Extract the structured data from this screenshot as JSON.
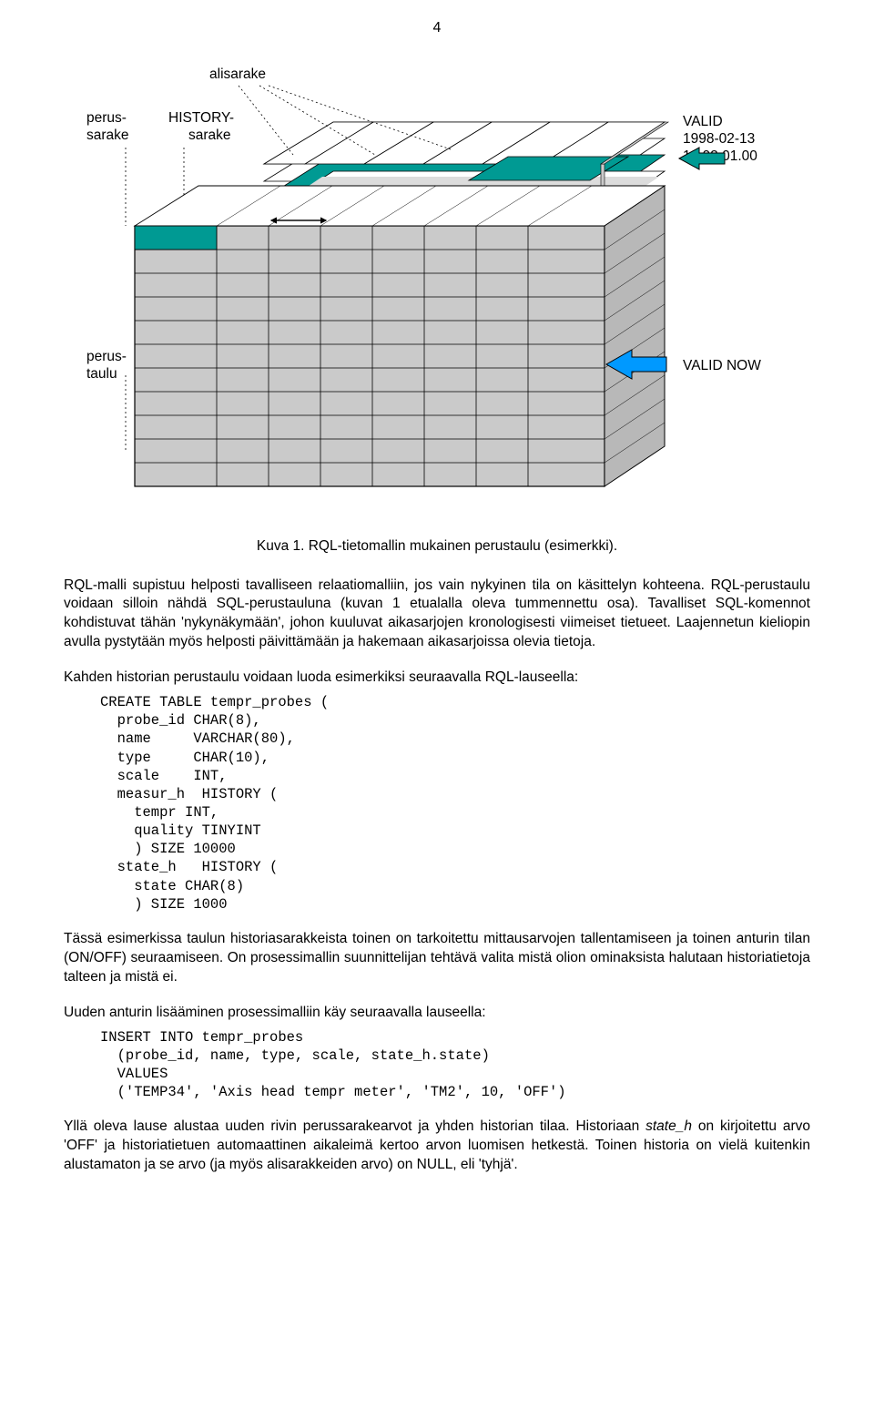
{
  "page_number": "4",
  "diagram": {
    "label_alisarake": "alisarake",
    "label_perussarake_line1": "perus-",
    "label_perussarake_line2": "sarake",
    "label_historysarake_line1": "HISTORY-",
    "label_historysarake_line2": "sarake",
    "label_valid_line1": "VALID",
    "label_valid_line2": "1998-02-13",
    "label_valid_line3": "14:02:01.00",
    "label_perustaulu_line1": "perus-",
    "label_perustaulu_line2": "taulu",
    "label_valid_now": "VALID NOW"
  },
  "caption": "Kuva 1. RQL-tietomallin mukainen perustaulu (esimerkki).",
  "para1": "RQL-malli supistuu helposti tavalliseen relaatiomalliin, jos vain nykyinen tila on käsittelyn kohteena. RQL-perustaulu voidaan silloin nähdä SQL-perustauluna (kuvan 1 etualalla oleva tummennettu osa). Tavalliset SQL-komennot kohdistuvat tähän 'nykynäkymään', johon kuuluvat aikasarjojen kronologisesti viimeiset tietueet. Laajennetun kieliopin avulla pystytään myös helposti päivittämään ja hakemaan aikasarjoissa olevia tietoja.",
  "para2": "Kahden historian perustaulu voidaan luoda esimerkiksi seuraavalla RQL-lauseella:",
  "code1": "CREATE TABLE tempr_probes (\n  probe_id CHAR(8),\n  name     VARCHAR(80),\n  type     CHAR(10),\n  scale    INT,\n  measur_h  HISTORY (\n    tempr INT,\n    quality TINYINT\n    ) SIZE 10000\n  state_h   HISTORY (\n    state CHAR(8)\n    ) SIZE 1000",
  "para3": "Tässä esimerkissa taulun historiasarakkeista toinen on tarkoitettu mittausarvojen tallentamiseen ja toinen anturin tilan (ON/OFF) seuraamiseen. On prosessimallin suunnittelijan tehtävä valita mistä olion ominaksista halutaan historiatietoja talteen ja mistä ei.",
  "para4": "Uuden anturin lisääminen prosessimalliin käy seuraavalla lauseella:",
  "code2": "INSERT INTO tempr_probes\n  (probe_id, name, type, scale, state_h.state)\n  VALUES\n  ('TEMP34', 'Axis head tempr meter', 'TM2', 10, 'OFF')",
  "para5_a": "Yllä oleva lause alustaa uuden rivin perussarakearvot ja yhden historian tilaa. Historiaan ",
  "para5_state": "state_h",
  "para5_b": " on kirjoitettu arvo 'OFF' ja historiatietuen automaattinen aikaleimä kertoo arvon luomisen hetkestä. Toinen historia on vielä kuitenkin alustamaton ja se arvo (ja myös alisarakkeiden arvo) on NULL, eli 'tyhjä'."
}
